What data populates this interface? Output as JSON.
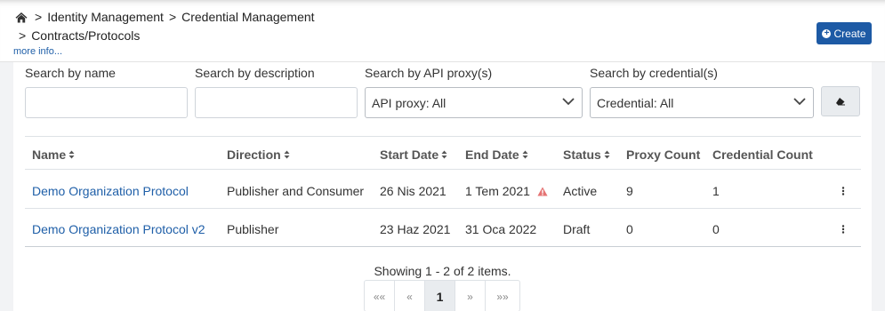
{
  "breadcrumb": {
    "home_icon": "home-icon",
    "separator": ">",
    "items": [
      "Identity Management",
      "Credential Management",
      "Contracts/Protocols"
    ]
  },
  "more_info": "more info...",
  "create_button": {
    "label": "Create",
    "icon": "plus-circle-icon"
  },
  "filters": {
    "name": {
      "label": "Search by name",
      "value": ""
    },
    "description": {
      "label": "Search by description",
      "value": ""
    },
    "api_proxy": {
      "label": "Search by API proxy(s)",
      "selected": "API proxy: All"
    },
    "credential": {
      "label": "Search by credential(s)",
      "selected": "Credential: All"
    },
    "clear_icon": "eraser-icon"
  },
  "table": {
    "columns": [
      "Name",
      "Direction",
      "Start Date",
      "End Date",
      "Status",
      "Proxy Count",
      "Credential Count"
    ],
    "rows": [
      {
        "name": "Demo Organization Protocol",
        "direction": "Publisher and Consumer",
        "start_date": "26 Nis 2021",
        "end_date": "1 Tem 2021",
        "end_date_warning": true,
        "status": "Active",
        "proxy_count": "9",
        "credential_count": "1"
      },
      {
        "name": "Demo Organization Protocol v2",
        "direction": "Publisher",
        "start_date": "23 Haz 2021",
        "end_date": "31 Oca 2022",
        "end_date_warning": false,
        "status": "Draft",
        "proxy_count": "0",
        "credential_count": "0"
      }
    ]
  },
  "footer": {
    "showing": "Showing 1 - 2 of 2 items.",
    "pagination": [
      "««",
      "«",
      "1",
      "»",
      "»»"
    ],
    "current_page": "1"
  },
  "colors": {
    "accent": "#1d5aa5",
    "link": "#1f5fa8",
    "warning": "#e57373"
  }
}
